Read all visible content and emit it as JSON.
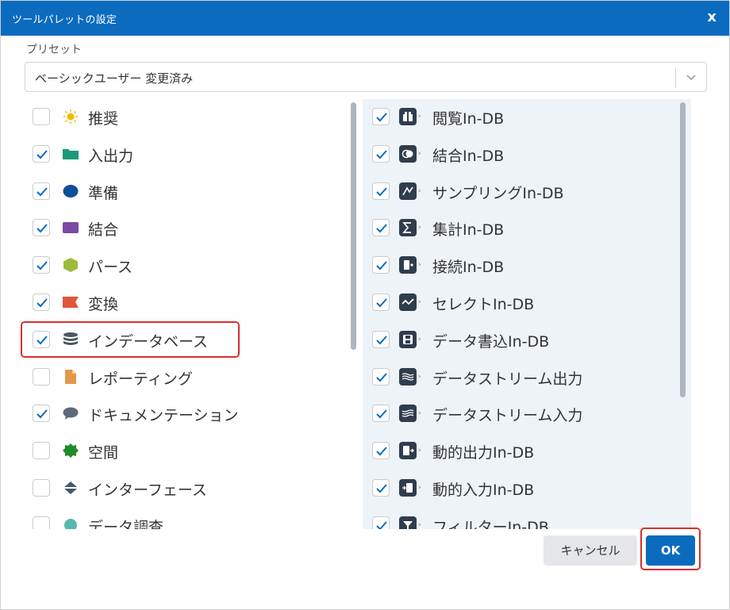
{
  "dialog": {
    "title": "ツールパレットの設定",
    "close_label": "x"
  },
  "preset": {
    "label": "プリセット",
    "value": "ベーシックユーザー 変更済み"
  },
  "categories": [
    {
      "label": "推奨",
      "checked": false,
      "icon": "sun-icon",
      "color": "#f5b800"
    },
    {
      "label": "入出力",
      "checked": true,
      "icon": "folder-icon",
      "color": "#1a9a7a"
    },
    {
      "label": "準備",
      "checked": true,
      "icon": "oval-icon",
      "color": "#0b4f9b"
    },
    {
      "label": "結合",
      "checked": true,
      "icon": "square-icon",
      "color": "#7a49a6"
    },
    {
      "label": "パース",
      "checked": true,
      "icon": "hexagon-icon",
      "color": "#9cbb3a"
    },
    {
      "label": "変換",
      "checked": true,
      "icon": "flag-icon",
      "color": "#e0553b"
    },
    {
      "label": "インデータベース",
      "checked": true,
      "icon": "database-icon",
      "color": "#4a5866"
    },
    {
      "label": "レポーティング",
      "checked": false,
      "icon": "document-icon",
      "color": "#e09a4a"
    },
    {
      "label": "ドキュメンテーション",
      "checked": true,
      "icon": "comment-icon",
      "color": "#5d6b7b"
    },
    {
      "label": "空間",
      "checked": false,
      "icon": "gear-icon",
      "color": "#1f8b2a"
    },
    {
      "label": "インターフェース",
      "checked": false,
      "icon": "diamond-icon",
      "color": "#4a5866"
    },
    {
      "label": "データ調査",
      "checked": false,
      "icon": "circle-icon",
      "color": "#57b8b0"
    }
  ],
  "tools": [
    {
      "label": "閲覧In-DB",
      "checked": true,
      "icon": "binoculars-icon"
    },
    {
      "label": "結合In-DB",
      "checked": true,
      "icon": "join-icon"
    },
    {
      "label": "サンプリングIn-DB",
      "checked": true,
      "icon": "sample-icon"
    },
    {
      "label": "集計In-DB",
      "checked": true,
      "icon": "sigma-icon"
    },
    {
      "label": "接続In-DB",
      "checked": true,
      "icon": "connect-icon"
    },
    {
      "label": "セレクトIn-DB",
      "checked": true,
      "icon": "select-icon"
    },
    {
      "label": "データ書込In-DB",
      "checked": true,
      "icon": "save-icon"
    },
    {
      "label": "データストリーム出力",
      "checked": true,
      "icon": "stream-out-icon"
    },
    {
      "label": "データストリーム入力",
      "checked": true,
      "icon": "stream-in-icon"
    },
    {
      "label": "動的出力In-DB",
      "checked": true,
      "icon": "dynamic-output-icon"
    },
    {
      "label": "動的入力In-DB",
      "checked": true,
      "icon": "dynamic-input-icon"
    },
    {
      "label": "フィルターIn-DB",
      "checked": true,
      "icon": "filter-icon"
    }
  ],
  "buttons": {
    "cancel": "キャンセル",
    "ok": "OK"
  },
  "colors": {
    "accent": "#0b6bbf",
    "highlight": "#d9302c",
    "check": "#0b6bbf",
    "tool_icon_bg": "#2f3d4d"
  }
}
